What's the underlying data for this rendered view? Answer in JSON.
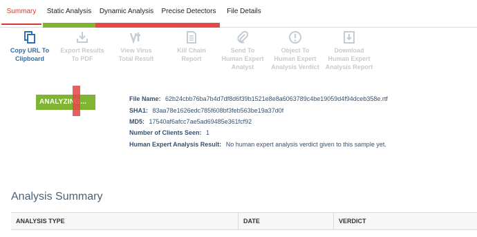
{
  "tabs": [
    {
      "label": "Summary",
      "active": true
    },
    {
      "label": "Static Analysis"
    },
    {
      "label": "Dynamic Analysis"
    },
    {
      "label": "Precise Detectors"
    },
    {
      "label": "File Details"
    }
  ],
  "progress": {
    "segments": [
      {
        "color": "#7fb533"
      },
      {
        "color": "#e44a4a"
      }
    ]
  },
  "toolbar": [
    {
      "label_1": "Copy URL To",
      "label_2": "Clipboard",
      "label_3": "",
      "icon": "copy-icon",
      "enabled": true
    },
    {
      "label_1": "Export Results",
      "label_2": "To PDF",
      "label_3": "",
      "icon": "download-icon",
      "enabled": false
    },
    {
      "label_1": "View Virus",
      "label_2": "Total Result",
      "label_3": "",
      "icon": "virustotal-icon",
      "enabled": false
    },
    {
      "label_1": "Kill Chain",
      "label_2": "Report",
      "label_3": "",
      "icon": "report-icon",
      "enabled": false
    },
    {
      "label_1": "Send To",
      "label_2": "Human Expert",
      "label_3": "Analyst",
      "icon": "paperclip-icon",
      "enabled": false
    },
    {
      "label_1": "Object To",
      "label_2": "Human Expert",
      "label_3": "Analysis Verdict",
      "icon": "alert-icon",
      "enabled": false
    },
    {
      "label_1": "Download",
      "label_2": "Human Expert",
      "label_3": "Analysis Report",
      "icon": "download-report-icon",
      "enabled": false
    }
  ],
  "status": {
    "badge": "ANALYZING..."
  },
  "info": {
    "file_name_label": "File Name:",
    "file_name": "62b24cbb76ba7b4d7df8d6f39b1521e8e8a6063789c4be19059d4f94dceb358e.rtf",
    "sha1_label": "SHA1:",
    "sha1": "83aa78e1626edc785f608bf3feb563be19a37d0f",
    "md5_label": "MD5:",
    "md5": "17540af6afcc7ae5ad69485e361fcf92",
    "clients_label": "Number of Clients Seen:",
    "clients": "1",
    "verdict_label": "Human Expert Analysis Result:",
    "verdict": "No human expert analysis verdict given to this sample yet."
  },
  "summary": {
    "title": "Analysis Summary",
    "columns": [
      "ANALYSIS TYPE",
      "DATE",
      "VERDICT"
    ]
  },
  "colors": {
    "accent": "#d33a2c",
    "link": "#2d6fb0",
    "disabled": "#c5cbd2",
    "analyzing": "#7fb533"
  }
}
